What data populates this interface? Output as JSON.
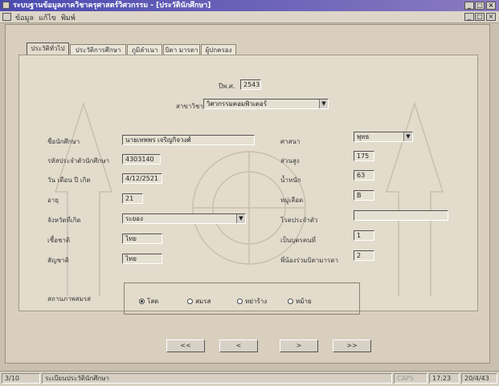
{
  "window": {
    "title": "ระบบฐานข้อมูลภาควิชาครุศาสตร์วิศวกรรม - [ประวัตินักศึกษา]"
  },
  "menu": [
    "ข้อมูล",
    "แก้ไข",
    "พิมพ์"
  ],
  "tabs": [
    "ประวัติทั่วไป",
    "ประวัติการศึกษา",
    "ภูมิลำเนา",
    "บิดา มารดา",
    "ผู้ปกครอง"
  ],
  "form": {
    "year_label": "ปีพ.ศ.",
    "year_value": "2543",
    "program_label": "สาขาวิชา",
    "program_value": "วิศวกรรมคอมพิวเตอร์",
    "left_fields": [
      {
        "label": "ชื่อนักศึกษา",
        "value": "นายเทพพร เจริญกิจวงศ์"
      },
      {
        "label": "รหัสประจำตัวนักศึกษา",
        "value": "4303140"
      },
      {
        "label": "วัน เดือน ปี เกิด",
        "value": "4/12/2521"
      },
      {
        "label": "อายุ",
        "value": "21"
      },
      {
        "label": "จังหวัดที่เกิด",
        "value": "ระยอง"
      },
      {
        "label": "เชื้อชาติ",
        "value": "ไทย"
      },
      {
        "label": "สัญชาติ",
        "value": "ไทย"
      }
    ],
    "right_fields": [
      {
        "label": "ศาสนา",
        "value": "พุทธ"
      },
      {
        "label": "ส่วนสูง",
        "value": "175"
      },
      {
        "label": "น้ำหนัก",
        "value": "63"
      },
      {
        "label": "หมู่เลือด",
        "value": "B"
      },
      {
        "label": "โรคประจำตัว",
        "value": ""
      },
      {
        "label": "เป็นบุตรคนที่",
        "value": "1"
      },
      {
        "label": "พี่น้องร่วมบิดามารดา",
        "value": "2"
      }
    ],
    "marital_label": "สถานภาพสมรส",
    "marital_options": [
      "โสด",
      "สมรส",
      "หย่าร้าง",
      "หม้าย"
    ],
    "marital_selected": "โสด"
  },
  "nav": [
    "<<",
    "<",
    ">",
    ">>"
  ],
  "status": {
    "record": "3/10",
    "form_name": "ระเบียนประวัตินักศึกษา",
    "caps": "CAPS",
    "time": "17:23",
    "date": "20/4/43"
  }
}
